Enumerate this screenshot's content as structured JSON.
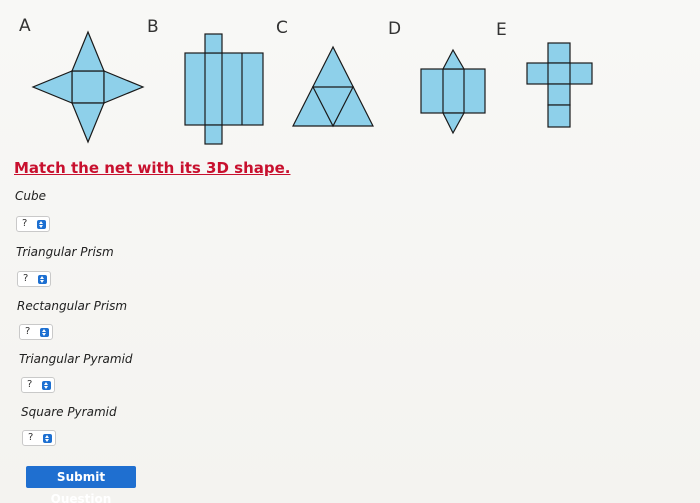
{
  "nets": {
    "labels": [
      "A",
      "B",
      "C",
      "D",
      "E"
    ],
    "fill_color": "#8ed0ea",
    "stroke_color": "#1a1a1a"
  },
  "instruction": "Match the net with its 3D shape.",
  "questions": [
    {
      "label": "Cube",
      "selected": "?"
    },
    {
      "label": "Triangular Prism",
      "selected": "?"
    },
    {
      "label": "Rectangular Prism",
      "selected": "?"
    },
    {
      "label": "Triangular Pyramid",
      "selected": "?"
    },
    {
      "label": "Square Pyramid",
      "selected": "?"
    }
  ],
  "submit_label": "Submit Question",
  "colors": {
    "instruction": "#c8102e",
    "button": "#1f6fd0",
    "select_arrow": "#1c6fd1"
  }
}
